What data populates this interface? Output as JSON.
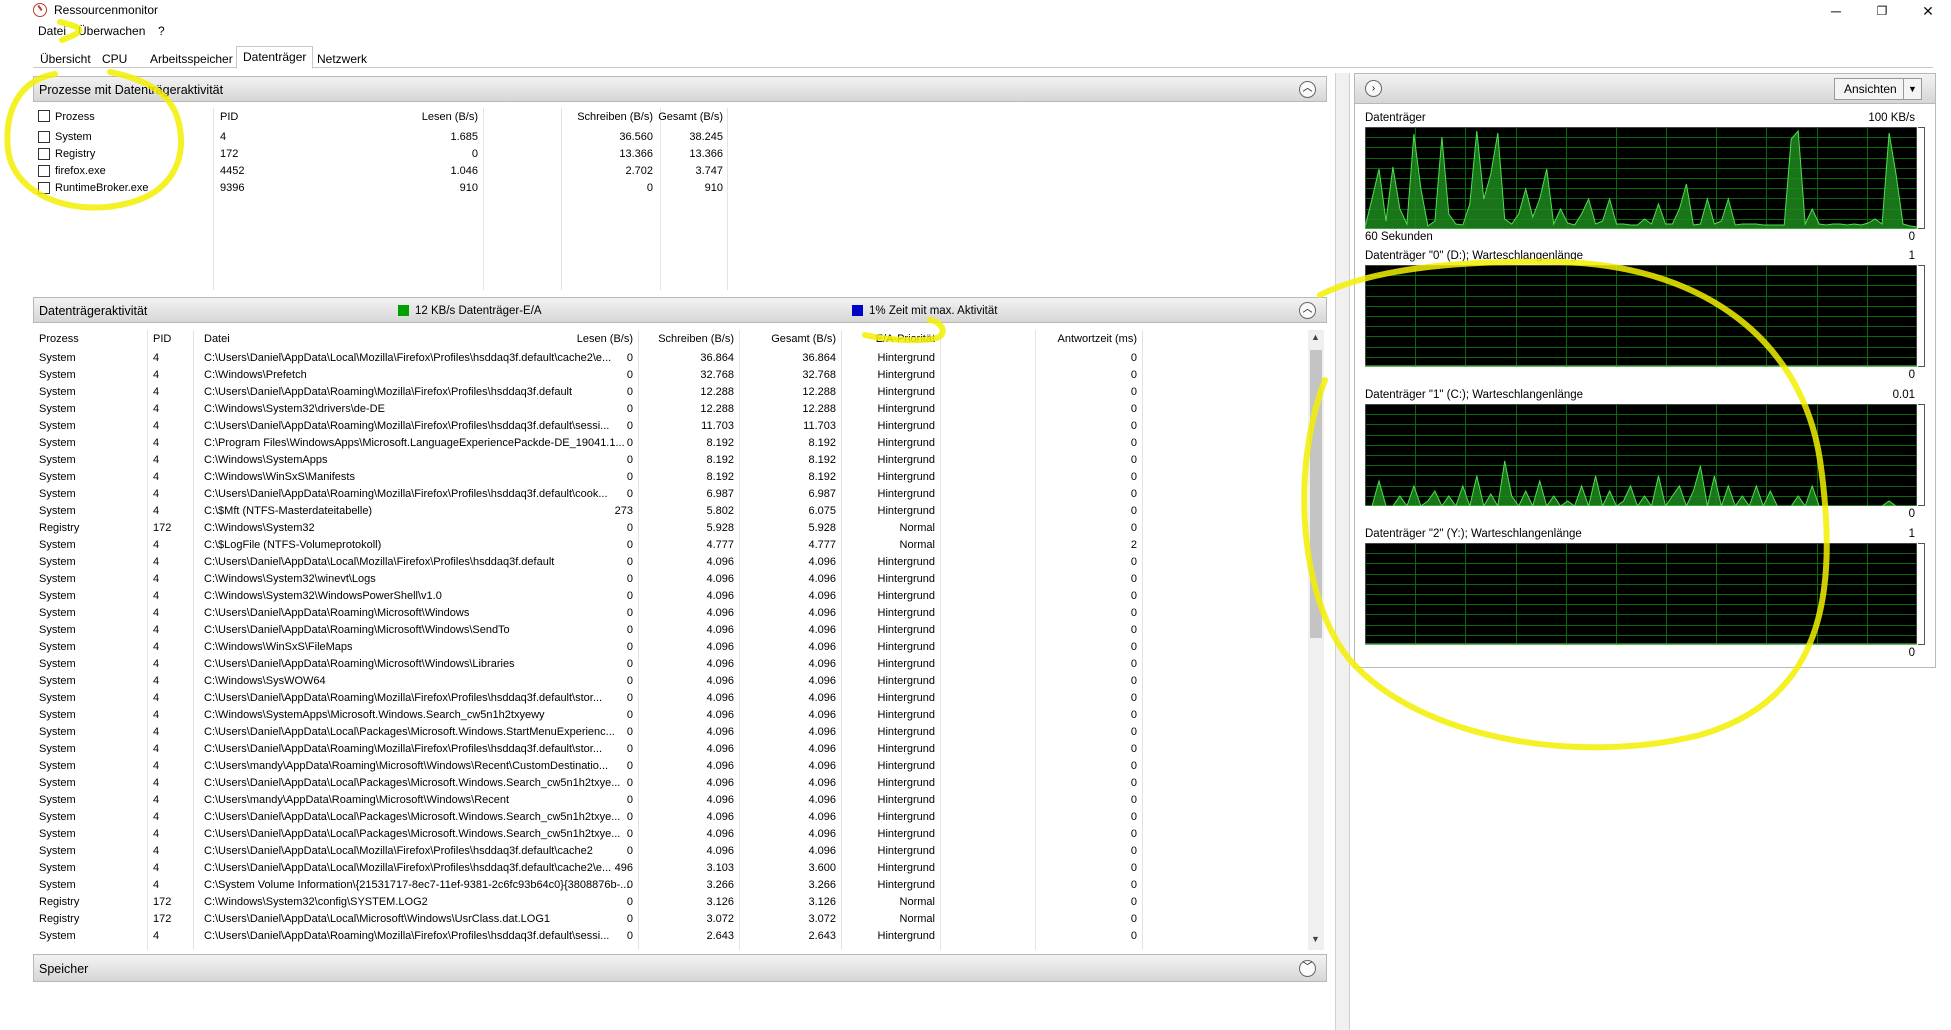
{
  "window": {
    "title": "Ressourcenmonitor",
    "minimize_glyph": "─",
    "maximize_glyph": "❐",
    "close_glyph": "✕"
  },
  "menu": [
    "Datei",
    "Überwachen",
    "?"
  ],
  "tabs": [
    {
      "label": "Übersicht"
    },
    {
      "label": "CPU"
    },
    {
      "label": "Arbeitsspeicher"
    },
    {
      "label": "Datenträger",
      "active": true
    },
    {
      "label": "Netzwerk"
    }
  ],
  "processes_panel": {
    "title": "Prozesse mit Datenträgeraktivität",
    "columns": [
      "Prozess",
      "PID",
      "Lesen (B/s)",
      "Schreiben (B/s)",
      "Gesamt (B/s)"
    ],
    "rows": [
      [
        "System",
        "4",
        "1.685",
        "36.560",
        "38.245"
      ],
      [
        "Registry",
        "172",
        "0",
        "13.366",
        "13.366"
      ],
      [
        "firefox.exe",
        "4452",
        "1.046",
        "2.702",
        "3.747"
      ],
      [
        "RuntimeBroker.exe",
        "9396",
        "910",
        "0",
        "910"
      ]
    ]
  },
  "activity_panel": {
    "title": "Datenträgeraktivität",
    "legend_io": "12 KB/s Datenträger-E/A",
    "legend_io_color": "#00a000",
    "legend_active": "1% Zeit mit max. Aktivität",
    "legend_active_color": "#0000c8",
    "columns": [
      "Prozess",
      "PID",
      "Datei",
      "Lesen (B/s)",
      "Schreiben (B/s)",
      "Gesamt (B/s)",
      "E/A-Priorität",
      "Antwortzeit (ms)"
    ],
    "rows": [
      [
        "System",
        "4",
        "C:\\Users\\Daniel\\AppData\\Local\\Mozilla\\Firefox\\Profiles\\hsddaq3f.default\\cache2\\e...",
        "0",
        "36.864",
        "36.864",
        "Hintergrund",
        "0"
      ],
      [
        "System",
        "4",
        "C:\\Windows\\Prefetch",
        "0",
        "32.768",
        "32.768",
        "Hintergrund",
        "0"
      ],
      [
        "System",
        "4",
        "C:\\Users\\Daniel\\AppData\\Roaming\\Mozilla\\Firefox\\Profiles\\hsddaq3f.default",
        "0",
        "12.288",
        "12.288",
        "Hintergrund",
        "0"
      ],
      [
        "System",
        "4",
        "C:\\Windows\\System32\\drivers\\de-DE",
        "0",
        "12.288",
        "12.288",
        "Hintergrund",
        "0"
      ],
      [
        "System",
        "4",
        "C:\\Users\\Daniel\\AppData\\Roaming\\Mozilla\\Firefox\\Profiles\\hsddaq3f.default\\sessi...",
        "0",
        "11.703",
        "11.703",
        "Hintergrund",
        "0"
      ],
      [
        "System",
        "4",
        "C:\\Program Files\\WindowsApps\\Microsoft.LanguageExperiencePackde-DE_19041.1...",
        "0",
        "8.192",
        "8.192",
        "Hintergrund",
        "0"
      ],
      [
        "System",
        "4",
        "C:\\Windows\\SystemApps",
        "0",
        "8.192",
        "8.192",
        "Hintergrund",
        "0"
      ],
      [
        "System",
        "4",
        "C:\\Windows\\WinSxS\\Manifests",
        "0",
        "8.192",
        "8.192",
        "Hintergrund",
        "0"
      ],
      [
        "System",
        "4",
        "C:\\Users\\Daniel\\AppData\\Roaming\\Mozilla\\Firefox\\Profiles\\hsddaq3f.default\\cook...",
        "0",
        "6.987",
        "6.987",
        "Hintergrund",
        "0"
      ],
      [
        "System",
        "4",
        "C:\\$Mft (NTFS-Masterdateitabelle)",
        "273",
        "5.802",
        "6.075",
        "Hintergrund",
        "0"
      ],
      [
        "Registry",
        "172",
        "C:\\Windows\\System32",
        "0",
        "5.928",
        "5.928",
        "Normal",
        "0"
      ],
      [
        "System",
        "4",
        "C:\\$LogFile (NTFS-Volumeprotokoll)",
        "0",
        "4.777",
        "4.777",
        "Normal",
        "2"
      ],
      [
        "System",
        "4",
        "C:\\Users\\Daniel\\AppData\\Local\\Mozilla\\Firefox\\Profiles\\hsddaq3f.default",
        "0",
        "4.096",
        "4.096",
        "Hintergrund",
        "0"
      ],
      [
        "System",
        "4",
        "C:\\Windows\\System32\\winevt\\Logs",
        "0",
        "4.096",
        "4.096",
        "Hintergrund",
        "0"
      ],
      [
        "System",
        "4",
        "C:\\Windows\\System32\\WindowsPowerShell\\v1.0",
        "0",
        "4.096",
        "4.096",
        "Hintergrund",
        "0"
      ],
      [
        "System",
        "4",
        "C:\\Users\\Daniel\\AppData\\Roaming\\Microsoft\\Windows",
        "0",
        "4.096",
        "4.096",
        "Hintergrund",
        "0"
      ],
      [
        "System",
        "4",
        "C:\\Users\\Daniel\\AppData\\Roaming\\Microsoft\\Windows\\SendTo",
        "0",
        "4.096",
        "4.096",
        "Hintergrund",
        "0"
      ],
      [
        "System",
        "4",
        "C:\\Windows\\WinSxS\\FileMaps",
        "0",
        "4.096",
        "4.096",
        "Hintergrund",
        "0"
      ],
      [
        "System",
        "4",
        "C:\\Users\\Daniel\\AppData\\Roaming\\Microsoft\\Windows\\Libraries",
        "0",
        "4.096",
        "4.096",
        "Hintergrund",
        "0"
      ],
      [
        "System",
        "4",
        "C:\\Windows\\SysWOW64",
        "0",
        "4.096",
        "4.096",
        "Hintergrund",
        "0"
      ],
      [
        "System",
        "4",
        "C:\\Users\\Daniel\\AppData\\Roaming\\Mozilla\\Firefox\\Profiles\\hsddaq3f.default\\stor...",
        "0",
        "4.096",
        "4.096",
        "Hintergrund",
        "0"
      ],
      [
        "System",
        "4",
        "C:\\Windows\\SystemApps\\Microsoft.Windows.Search_cw5n1h2txyewy",
        "0",
        "4.096",
        "4.096",
        "Hintergrund",
        "0"
      ],
      [
        "System",
        "4",
        "C:\\Users\\Daniel\\AppData\\Local\\Packages\\Microsoft.Windows.StartMenuExperienc...",
        "0",
        "4.096",
        "4.096",
        "Hintergrund",
        "0"
      ],
      [
        "System",
        "4",
        "C:\\Users\\Daniel\\AppData\\Roaming\\Mozilla\\Firefox\\Profiles\\hsddaq3f.default\\stor...",
        "0",
        "4.096",
        "4.096",
        "Hintergrund",
        "0"
      ],
      [
        "System",
        "4",
        "C:\\Users\\mandy\\AppData\\Roaming\\Microsoft\\Windows\\Recent\\CustomDestinatio...",
        "0",
        "4.096",
        "4.096",
        "Hintergrund",
        "0"
      ],
      [
        "System",
        "4",
        "C:\\Users\\Daniel\\AppData\\Local\\Packages\\Microsoft.Windows.Search_cw5n1h2txye...",
        "0",
        "4.096",
        "4.096",
        "Hintergrund",
        "0"
      ],
      [
        "System",
        "4",
        "C:\\Users\\mandy\\AppData\\Roaming\\Microsoft\\Windows\\Recent",
        "0",
        "4.096",
        "4.096",
        "Hintergrund",
        "0"
      ],
      [
        "System",
        "4",
        "C:\\Users\\Daniel\\AppData\\Local\\Packages\\Microsoft.Windows.Search_cw5n1h2txye...",
        "0",
        "4.096",
        "4.096",
        "Hintergrund",
        "0"
      ],
      [
        "System",
        "4",
        "C:\\Users\\Daniel\\AppData\\Local\\Packages\\Microsoft.Windows.Search_cw5n1h2txye...",
        "0",
        "4.096",
        "4.096",
        "Hintergrund",
        "0"
      ],
      [
        "System",
        "4",
        "C:\\Users\\Daniel\\AppData\\Local\\Mozilla\\Firefox\\Profiles\\hsddaq3f.default\\cache2",
        "0",
        "4.096",
        "4.096",
        "Hintergrund",
        "0"
      ],
      [
        "System",
        "4",
        "C:\\Users\\Daniel\\AppData\\Local\\Mozilla\\Firefox\\Profiles\\hsddaq3f.default\\cache2\\e...",
        "496",
        "3.103",
        "3.600",
        "Hintergrund",
        "0"
      ],
      [
        "System",
        "4",
        "C:\\System Volume Information\\{21531717-8ec7-11ef-9381-2c6fc93b64c0}{3808876b-...",
        "0",
        "3.266",
        "3.266",
        "Hintergrund",
        "0"
      ],
      [
        "Registry",
        "172",
        "C:\\Windows\\System32\\config\\SYSTEM.LOG2",
        "0",
        "3.126",
        "3.126",
        "Normal",
        "0"
      ],
      [
        "Registry",
        "172",
        "C:\\Users\\Daniel\\AppData\\Local\\Microsoft\\Windows\\UsrClass.dat.LOG1",
        "0",
        "3.072",
        "3.072",
        "Normal",
        "0"
      ],
      [
        "System",
        "4",
        "C:\\Users\\Daniel\\AppData\\Roaming\\Mozilla\\Firefox\\Profiles\\hsddaq3f.default\\sessi...",
        "0",
        "2.643",
        "2.643",
        "Hintergrund",
        "0"
      ]
    ]
  },
  "memory_panel": {
    "title": "Speicher"
  },
  "right_pane": {
    "views_label": "Ansichten",
    "graphs": [
      {
        "title": "Datenträger",
        "max_label": "100 KB/s",
        "time_label": "60 Sekunden",
        "min_label": "0",
        "values": [
          2,
          30,
          60,
          8,
          62,
          20,
          5,
          95,
          40,
          3,
          8,
          92,
          15,
          5,
          4,
          25,
          98,
          30,
          55,
          96,
          10,
          5,
          15,
          40,
          12,
          30,
          60,
          5,
          20,
          6,
          4,
          15,
          30,
          5,
          8,
          30,
          5,
          5,
          4,
          4,
          10,
          5,
          25,
          5,
          5,
          20,
          45,
          4,
          5,
          30,
          5,
          8,
          30,
          4,
          5,
          5,
          5,
          4,
          4,
          4,
          4,
          90,
          98,
          5,
          20,
          5,
          4,
          5,
          5,
          4,
          5,
          4,
          6,
          10,
          5,
          96,
          55,
          5,
          3,
          2
        ]
      },
      {
        "title": "Datenträger \"0\" (D:); Warteschlangenlänge",
        "max_label": "1",
        "min_label": "0",
        "values": []
      },
      {
        "title": "Datenträger \"1\" (C:); Warteschlangenlänge",
        "max_label": "0.01",
        "min_label": "0",
        "values": [
          0,
          0,
          25,
          0,
          0,
          10,
          0,
          20,
          0,
          5,
          15,
          0,
          10,
          0,
          20,
          0,
          30,
          0,
          12,
          0,
          45,
          10,
          0,
          15,
          0,
          25,
          0,
          10,
          0,
          5,
          0,
          20,
          0,
          30,
          0,
          15,
          0,
          5,
          20,
          0,
          10,
          0,
          30,
          0,
          10,
          20,
          0,
          15,
          40,
          0,
          30,
          0,
          20,
          0,
          10,
          0,
          20,
          0,
          15,
          0,
          0,
          0,
          10,
          0,
          20,
          0,
          0,
          0,
          0,
          0,
          0,
          0,
          0,
          0,
          0,
          5,
          0,
          0,
          0,
          0
        ]
      },
      {
        "title": "Datenträger \"2\" (Y:); Warteschlangenlänge",
        "max_label": "1",
        "min_label": "0",
        "values": []
      }
    ]
  }
}
